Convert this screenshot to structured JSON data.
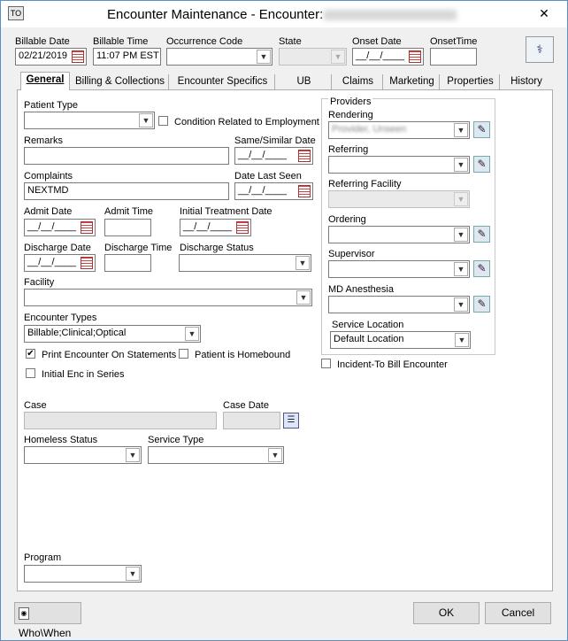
{
  "window": {
    "title": "Encounter Maintenance - Encounter:",
    "close_icon": "close-icon"
  },
  "header": {
    "billable_date_label": "Billable Date",
    "billable_date_value": "02/21/2019",
    "billable_time_label": "Billable Time",
    "billable_time_value": "11:07 PM EST",
    "occurrence_code_label": "Occurrence Code",
    "occurrence_code_value": "",
    "state_label": "State",
    "state_value": "",
    "onset_date_label": "Onset Date",
    "onset_date_value": "__/__/____",
    "onset_time_label": "OnsetTime",
    "onset_time_value": ""
  },
  "tabs": [
    {
      "label": "General",
      "active": true
    },
    {
      "label": "Billing & Collections"
    },
    {
      "label": "Encounter Specifics"
    },
    {
      "label": "UB"
    },
    {
      "label": "Claims"
    },
    {
      "label": "Marketing"
    },
    {
      "label": "Properties"
    },
    {
      "label": "History"
    }
  ],
  "general": {
    "patient_type_label": "Patient Type",
    "patient_type_value": "",
    "condition_employment_label": "Condition Related to Employment",
    "remarks_label": "Remarks",
    "remarks_value": "",
    "same_similar_date_label": "Same/Similar Date",
    "same_similar_date_value": "__/__/____",
    "complaints_label": "Complaints",
    "complaints_value": "NEXTMD",
    "date_last_seen_label": "Date Last Seen",
    "date_last_seen_value": "__/__/____",
    "admit_date_label": "Admit Date",
    "admit_date_value": "__/__/____",
    "admit_time_label": "Admit Time",
    "admit_time_value": "",
    "initial_treatment_date_label": "Initial Treatment Date",
    "initial_treatment_date_value": "__/__/____",
    "discharge_date_label": "Discharge Date",
    "discharge_date_value": "__/__/____",
    "discharge_time_label": "Discharge Time",
    "discharge_time_value": "",
    "discharge_status_label": "Discharge Status",
    "discharge_status_value": "",
    "facility_label": "Facility",
    "facility_value": "",
    "encounter_types_label": "Encounter Types",
    "encounter_types_value": "Billable;Clinical;Optical",
    "print_on_statements_label": "Print Encounter On Statements",
    "print_on_statements_checked": true,
    "homebound_label": "Patient is Homebound",
    "homebound_checked": false,
    "initial_enc_label": "Initial Enc in Series",
    "initial_enc_checked": false,
    "case_label": "Case",
    "case_value": "",
    "case_date_label": "Case Date",
    "case_date_value": "",
    "homeless_status_label": "Homeless Status",
    "homeless_status_value": "",
    "service_type_label": "Service Type",
    "service_type_value": "",
    "program_label": "Program",
    "program_value": ""
  },
  "providers": {
    "group_label": "Providers",
    "rendering_label": "Rendering",
    "rendering_value": "Provider, Unseen",
    "referring_label": "Referring",
    "referring_value": "",
    "referring_facility_label": "Referring Facility",
    "referring_facility_value": "",
    "ordering_label": "Ordering",
    "ordering_value": "",
    "supervisor_label": "Supervisor",
    "supervisor_value": "",
    "md_anesthesia_label": "MD Anesthesia",
    "md_anesthesia_value": "",
    "service_location_label": "Service Location",
    "service_location_value": "Default Location",
    "incident_to_label": "Incident-To Bill Encounter",
    "incident_to_checked": false
  },
  "footer": {
    "who_when_label": "Who\\When",
    "ok_label": "OK",
    "cancel_label": "Cancel"
  }
}
